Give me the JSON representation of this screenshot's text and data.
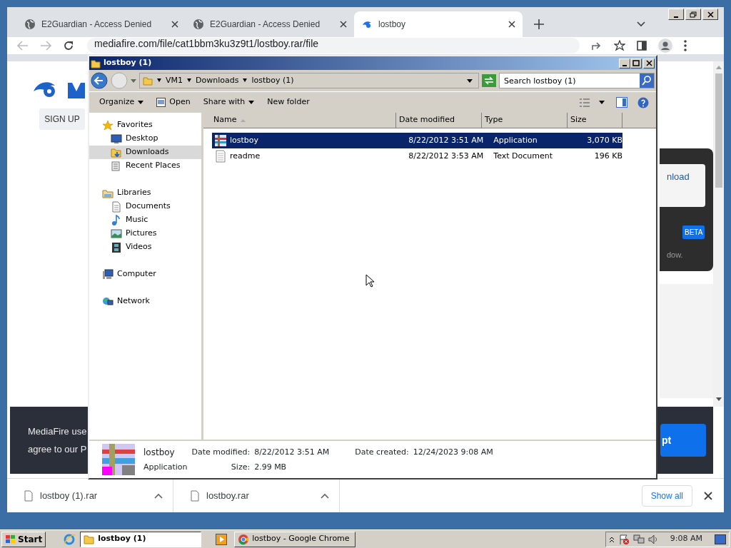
{
  "browser": {
    "tabs": [
      {
        "title": "E2Guardian - Access Denied",
        "selected": false
      },
      {
        "title": "E2Guardian - Access Denied",
        "selected": false
      },
      {
        "title": "lostboy",
        "selected": true
      }
    ],
    "address": "mediafire.com/file/cat1bbm3ku3z9t1/lostboy.rar/file"
  },
  "page": {
    "signup": "SIGN UP",
    "download_fragment": "nload",
    "badge": "BETA",
    "note_fragment": "dow.",
    "cookie_lines": [
      "MediaFire use",
      "agree to our P"
    ],
    "accept_fragment": "pt"
  },
  "downloads": [
    {
      "name": "lostboy (1).rar"
    },
    {
      "name": "lostboy.rar"
    }
  ],
  "show_all": "Show all",
  "explorer": {
    "title": "lostboy (1)",
    "breadcrumb": [
      "VM1",
      "Downloads",
      "lostboy (1)"
    ],
    "search_placeholder": "Search lostboy (1)",
    "commands": [
      {
        "label": "Organize",
        "kind": "menu"
      },
      {
        "label": "Open",
        "kind": "open"
      },
      {
        "label": "Share with",
        "kind": "menu"
      },
      {
        "label": "New folder",
        "kind": "plain"
      }
    ],
    "nav": [
      {
        "label": "Favorites",
        "children": [
          {
            "label": "Desktop",
            "selected": false
          },
          {
            "label": "Downloads",
            "selected": true
          },
          {
            "label": "Recent Places",
            "selected": false
          }
        ]
      },
      {
        "label": "Libraries",
        "children": [
          {
            "label": "Documents",
            "selected": false
          },
          {
            "label": "Music",
            "selected": false
          },
          {
            "label": "Pictures",
            "selected": false
          },
          {
            "label": "Videos",
            "selected": false
          }
        ]
      },
      {
        "label": "Computer"
      },
      {
        "label": "Network"
      }
    ],
    "columns": [
      "Name",
      "Date modified",
      "Type",
      "Size"
    ],
    "files": [
      {
        "name": "lostboy",
        "date": "8/22/2012 3:51 AM",
        "type": "Application",
        "size": "3,070 KB",
        "selected": true,
        "kind": "app"
      },
      {
        "name": "readme",
        "date": "8/22/2012 3:53 AM",
        "type": "Text Document",
        "size": "196 KB",
        "selected": false,
        "kind": "text"
      }
    ],
    "details": {
      "name": "lostboy",
      "type": "Application",
      "modified_label": "Date modified:",
      "modified": "8/22/2012 3:51 AM",
      "created_label": "Date created:",
      "created": "12/24/2023 9:08 AM",
      "size_label": "Size:",
      "size": "2.99 MB"
    }
  },
  "taskbar": {
    "start": "Start",
    "tasks": [
      {
        "label": "lostboy (1)",
        "selected": true
      },
      {
        "label": "lostboy - Google Chrome",
        "selected": false
      }
    ],
    "clock": "9:08 AM"
  }
}
